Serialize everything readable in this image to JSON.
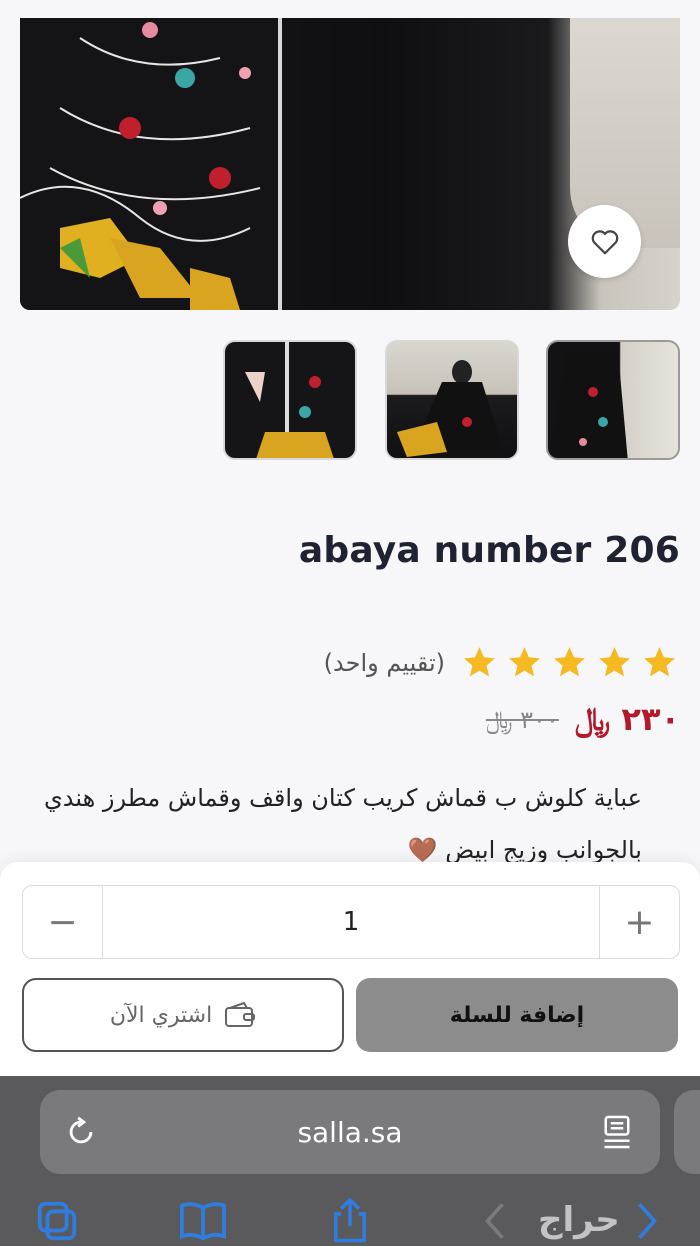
{
  "product": {
    "title": "abaya number 206",
    "rating_stars": 5,
    "rating_text": "(تقييم واحد)",
    "price": "٢٣٠ ﷼",
    "old_price": "٣٠٠ ﷼",
    "description": "عباية كلوش ب قماش كريب كتان واقف وقماش مطرز هندي بالجوانب وزيج ابيض 🤎",
    "thumbnails": [
      "thumbnail-1",
      "thumbnail-2",
      "thumbnail-3"
    ]
  },
  "cart": {
    "quantity": "1",
    "minus": "−",
    "plus": "+",
    "buy_now_label": "اشتري الآن",
    "add_to_cart_label": "إضافة للسلة"
  },
  "browser": {
    "url": "salla.sa",
    "watermark": "حراج"
  },
  "colors": {
    "price": "#b11a2c",
    "star": "#f5b921",
    "add_cart_bg": "#8c8c8c"
  }
}
